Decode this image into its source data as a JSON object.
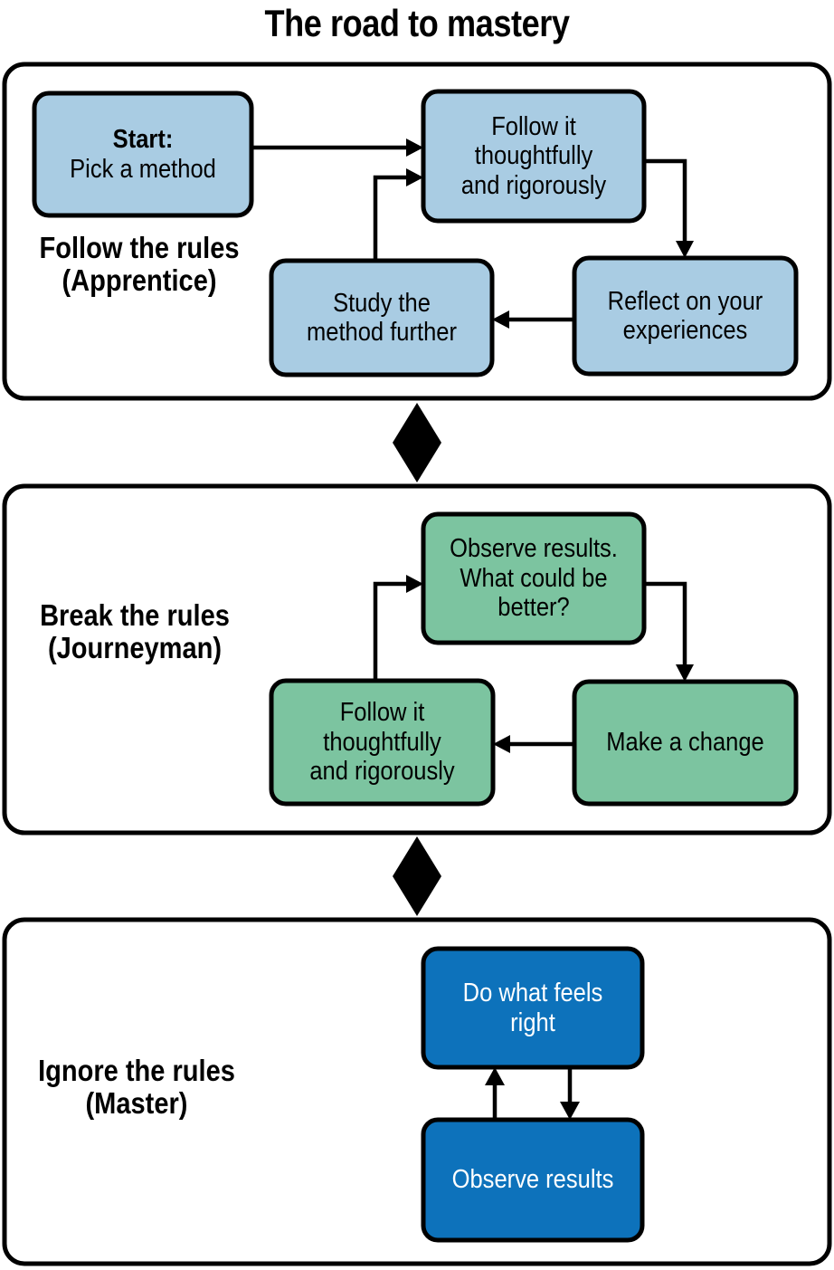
{
  "title": "The road to mastery",
  "colors": {
    "apprentice_fill": "#a9cce3",
    "journeyman_fill": "#7cc4a0",
    "master_fill": "#0d72bb",
    "stroke": "#000000",
    "panel_fill": "#ffffff",
    "master_text": "#ffffff"
  },
  "sections": [
    {
      "id": "apprentice",
      "label_line1": "Follow the rules",
      "label_line2": "(Apprentice)",
      "nodes": [
        {
          "id": "start",
          "line1": "Start:",
          "line2": "Pick a method",
          "bold_line1": true
        },
        {
          "id": "follow-1",
          "line1": "Follow it",
          "line2": "thoughtfully",
          "line3": "and rigorously"
        },
        {
          "id": "reflect",
          "line1": "Reflect on your",
          "line2": "experiences"
        },
        {
          "id": "study",
          "line1": "Study the",
          "line2": "method further"
        }
      ]
    },
    {
      "id": "journeyman",
      "label_line1": "Break the rules",
      "label_line2": "(Journeyman)",
      "nodes": [
        {
          "id": "observe-what",
          "line1": "Observe results.",
          "line2": "What could be",
          "line3": "better?"
        },
        {
          "id": "make-change",
          "line1": "Make a change"
        },
        {
          "id": "follow-2",
          "line1": "Follow it",
          "line2": "thoughtfully",
          "line3": "and rigorously"
        }
      ]
    },
    {
      "id": "master",
      "label_line1": "Ignore the rules",
      "label_line2": "(Master)",
      "nodes": [
        {
          "id": "do-what-feels-right",
          "line1": "Do what feels",
          "line2": "right"
        },
        {
          "id": "observe-results",
          "line1": "Observe results"
        }
      ]
    }
  ],
  "connectors": {
    "apprentice": [
      "start -> follow-1",
      "follow-1 -> reflect",
      "reflect -> study",
      "study -> follow-1"
    ],
    "between_1_2": "bidirectional",
    "journeyman": [
      "observe-what -> make-change",
      "make-change -> follow-2",
      "follow-2 -> observe-what"
    ],
    "between_2_3": "bidirectional",
    "master": [
      "do-what-feels-right -> observe-results",
      "observe-results -> do-what-feels-right"
    ]
  },
  "chart_data": {
    "type": "diagram",
    "title": "The road to mastery",
    "subtype": "flowchart",
    "stages": [
      {
        "name": "Follow the rules (Apprentice)",
        "color": "#a9cce3",
        "steps": [
          "Start: Pick a method",
          "Follow it thoughtfully and rigorously",
          "Reflect on your experiences",
          "Study the method further"
        ],
        "cycle": true
      },
      {
        "name": "Break the rules (Journeyman)",
        "color": "#7cc4a0",
        "steps": [
          "Observe results. What could be better?",
          "Make a change",
          "Follow it thoughtfully and rigorously"
        ],
        "cycle": true
      },
      {
        "name": "Ignore the rules (Master)",
        "color": "#0d72bb",
        "steps": [
          "Do what feels right",
          "Observe results"
        ],
        "cycle": true
      }
    ]
  }
}
